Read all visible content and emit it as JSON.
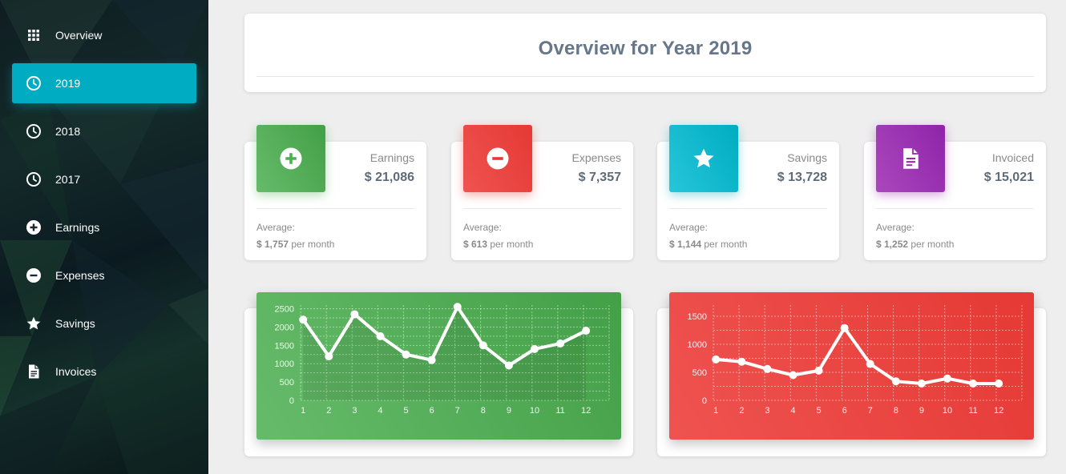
{
  "sidebar": {
    "items": [
      {
        "label": "Overview",
        "icon": "grid-icon",
        "active": false
      },
      {
        "label": "2019",
        "icon": "clock-icon",
        "active": true
      },
      {
        "label": "2018",
        "icon": "clock-icon",
        "active": false
      },
      {
        "label": "2017",
        "icon": "clock-icon",
        "active": false
      },
      {
        "label": "Earnings",
        "icon": "plus-circle-icon",
        "active": false
      },
      {
        "label": "Expenses",
        "icon": "minus-circle-icon",
        "active": false
      },
      {
        "label": "Savings",
        "icon": "star-icon",
        "active": false
      },
      {
        "label": "Invoices",
        "icon": "document-icon",
        "active": false
      }
    ],
    "active_color": "#00acc1"
  },
  "header": {
    "title": "Overview for Year 2019"
  },
  "stats": [
    {
      "label": "Earnings",
      "value": "$ 21,086",
      "avg_label": "Average:",
      "avg_value": "$ 1,757",
      "avg_suffix": " per month",
      "icon": "plus-circle-icon",
      "color": "#4caf50"
    },
    {
      "label": "Expenses",
      "value": "$ 7,357",
      "avg_label": "Average:",
      "avg_value": "$ 613",
      "avg_suffix": " per month",
      "icon": "minus-circle-icon",
      "color": "#e53935"
    },
    {
      "label": "Savings",
      "value": "$ 13,728",
      "avg_label": "Average:",
      "avg_value": "$ 1,144",
      "avg_suffix": " per month",
      "icon": "star-icon",
      "color": "#00acc1"
    },
    {
      "label": "Invoiced",
      "value": "$ 15,021",
      "avg_label": "Average:",
      "avg_value": "$ 1,252",
      "avg_suffix": " per month",
      "icon": "document-icon",
      "color": "#9c27b0"
    }
  ],
  "chart_data": [
    {
      "type": "area",
      "title": "",
      "x": [
        "1",
        "2",
        "3",
        "4",
        "5",
        "6",
        "7",
        "8",
        "9",
        "10",
        "11",
        "12"
      ],
      "values": [
        2200,
        1200,
        2350,
        1750,
        1250,
        1100,
        2550,
        1500,
        950,
        1400,
        1550,
        1900
      ],
      "yticks": [
        0,
        500,
        1000,
        1500,
        2000,
        2500
      ],
      "ylim": [
        0,
        2600
      ],
      "color": "#4caf50",
      "grid": true
    },
    {
      "type": "line",
      "title": "",
      "x": [
        "1",
        "2",
        "3",
        "4",
        "5",
        "6",
        "7",
        "8",
        "9",
        "10",
        "11",
        "12"
      ],
      "values": [
        730,
        690,
        560,
        450,
        530,
        1290,
        650,
        340,
        300,
        390,
        300,
        300
      ],
      "yticks": [
        0,
        500,
        1000,
        1500
      ],
      "ylim": [
        0,
        1700
      ],
      "color": "#e53935",
      "grid": true
    }
  ]
}
